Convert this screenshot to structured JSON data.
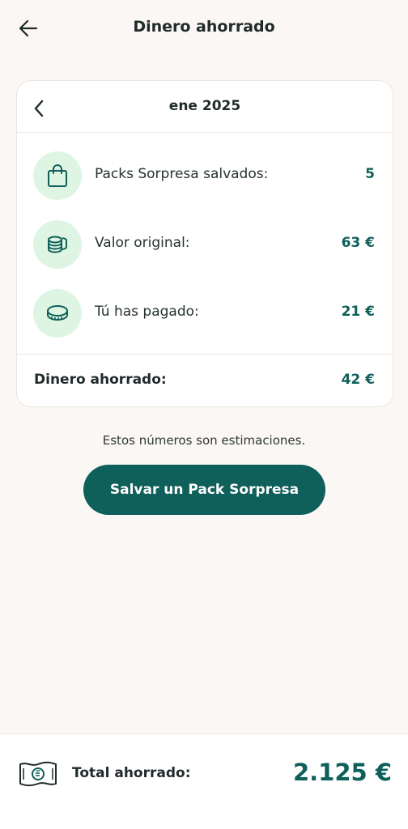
{
  "header": {
    "title": "Dinero ahorrado",
    "back_icon": "arrow-left-icon"
  },
  "card": {
    "month": "ene 2025",
    "prev_icon": "chevron-left-icon",
    "stats": [
      {
        "icon": "bag-icon",
        "label": "Packs Sorpresa salvados:",
        "value": "5"
      },
      {
        "icon": "coin-stack-icon",
        "label": "Valor original:",
        "value": "63 €"
      },
      {
        "icon": "coin-icon",
        "label": "Tú has pagado:",
        "value": "21 €"
      }
    ],
    "saved": {
      "label": "Dinero ahorrado:",
      "value": "42 €"
    }
  },
  "disclaimer": "Estos números son estimaciones.",
  "cta": {
    "label": "Salvar un Pack Sorpresa"
  },
  "footer": {
    "icon": "banknote-icon",
    "label": "Total ahorrado:",
    "value": "2.125 €"
  },
  "colors": {
    "background": "#fbf7f4",
    "accent": "#0f5f5a",
    "icon_bg": "#dff5e3",
    "card": "#ffffff"
  }
}
